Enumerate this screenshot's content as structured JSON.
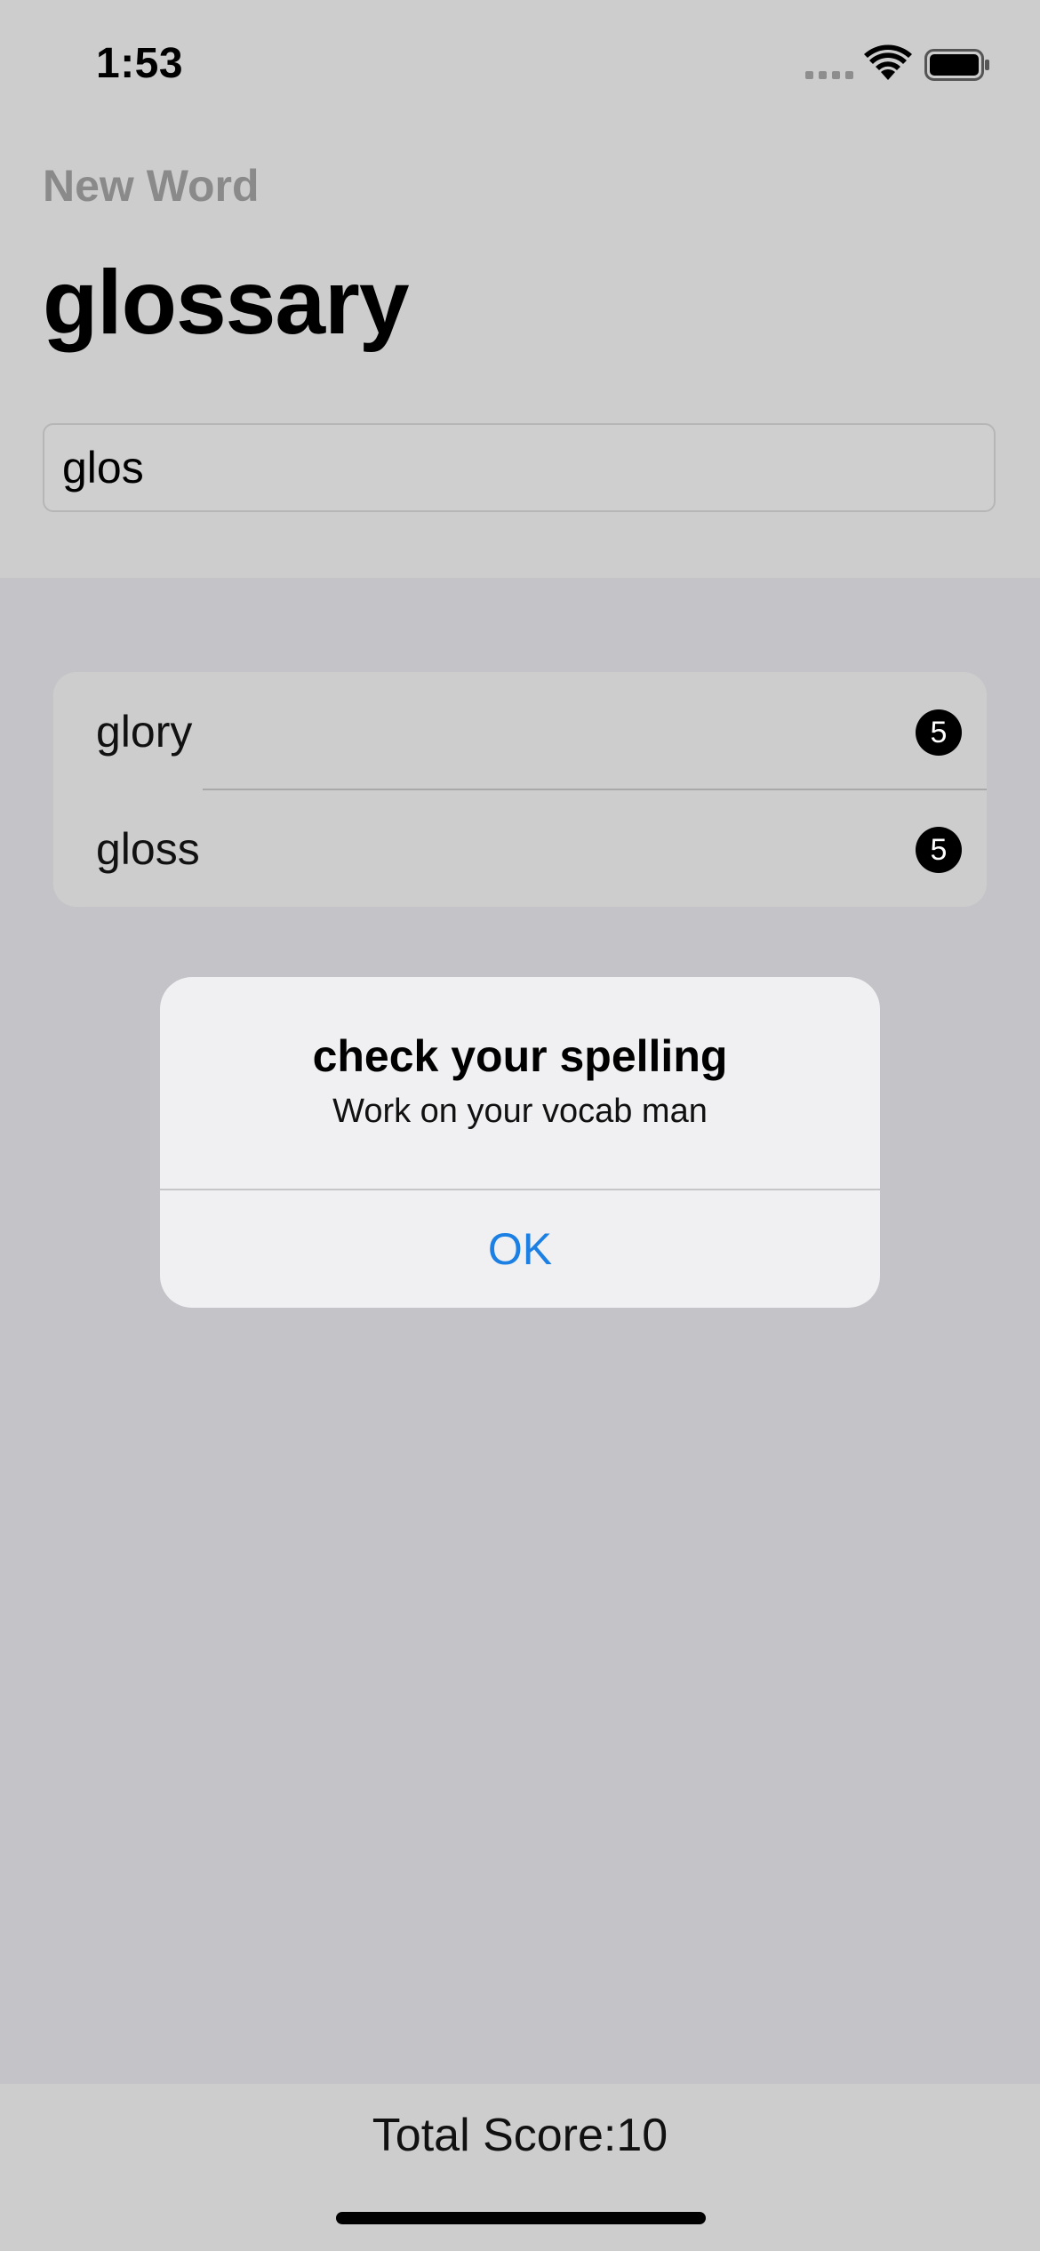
{
  "status_bar": {
    "time": "1:53"
  },
  "header": {
    "subtitle": "New Word",
    "title": "glossary",
    "input_value": "glos"
  },
  "word_list": [
    {
      "word": "glory",
      "score": "5"
    },
    {
      "word": "gloss",
      "score": "5"
    }
  ],
  "alert": {
    "title": "check your spelling",
    "message": "Work on your vocab man",
    "button_label": "OK"
  },
  "footer": {
    "score_text": "Total Score:10"
  },
  "colors": {
    "accent": "#1b7fe3",
    "badge": "#000000"
  }
}
